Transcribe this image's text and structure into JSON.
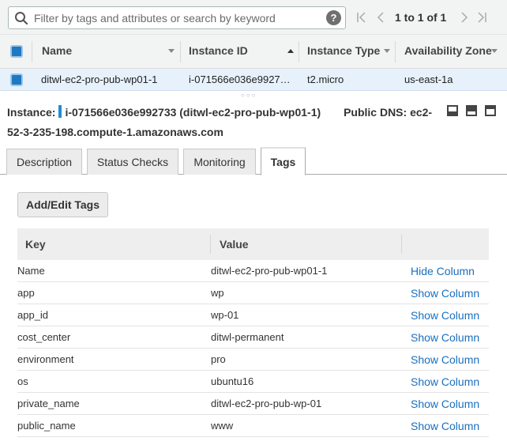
{
  "filter": {
    "placeholder": "Filter by tags and attributes or search by keyword",
    "value": "",
    "help_label": "?"
  },
  "pager": {
    "text": "1 to 1 of 1"
  },
  "instances": {
    "columns": [
      "Name",
      "Instance ID",
      "Instance Type",
      "Availability Zone"
    ],
    "rows": [
      {
        "name": "ditwl-ec2-pro-pub-wp01-1",
        "instance_id": "i-071566e036e9927…",
        "instance_type": "t2.micro",
        "availability_zone": "us-east-1a"
      }
    ]
  },
  "summary": {
    "instance_label": "Instance:",
    "instance_value": "i-071566e036e992733 (ditwl-ec2-pro-pub-wp01-1)",
    "dns_label": "Public DNS: ec2-",
    "dns_value": "52-3-235-198.compute-1.amazonaws.com"
  },
  "tabs": [
    "Description",
    "Status Checks",
    "Monitoring",
    "Tags"
  ],
  "active_tab": "Tags",
  "tags_panel": {
    "add_button": "Add/Edit Tags",
    "columns": {
      "key": "Key",
      "value": "Value"
    },
    "rows": [
      {
        "key": "Name",
        "value": "ditwl-ec2-pro-pub-wp01-1",
        "action": "Hide Column"
      },
      {
        "key": "app",
        "value": "wp",
        "action": "Show Column"
      },
      {
        "key": "app_id",
        "value": "wp-01",
        "action": "Show Column"
      },
      {
        "key": "cost_center",
        "value": "ditwl-permanent",
        "action": "Show Column"
      },
      {
        "key": "environment",
        "value": "pro",
        "action": "Show Column"
      },
      {
        "key": "os",
        "value": "ubuntu16",
        "action": "Show Column"
      },
      {
        "key": "private_name",
        "value": "ditwl-ec2-pro-pub-wp-01",
        "action": "Show Column"
      },
      {
        "key": "public_name",
        "value": "www",
        "action": "Show Column"
      }
    ]
  },
  "colors": {
    "accent": "#1f78c1",
    "link": "#1b6fbf",
    "selected_row": "#e6f1fb"
  }
}
